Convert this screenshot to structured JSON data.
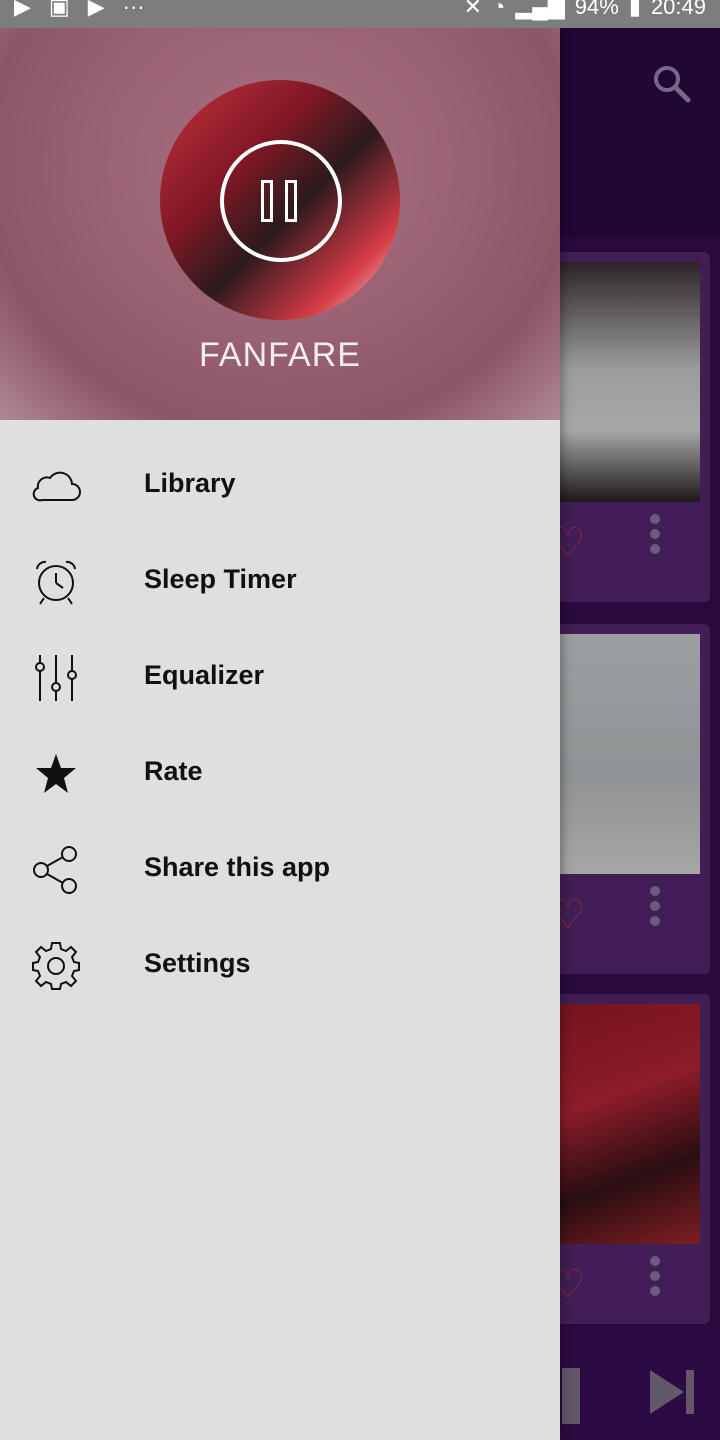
{
  "status_bar": {
    "battery": "94%",
    "time": "20:49"
  },
  "drawer": {
    "header_title": "FANFARE",
    "menu": [
      {
        "label": "Library",
        "icon": "cloud-icon"
      },
      {
        "label": "Sleep Timer",
        "icon": "alarm-clock-icon"
      },
      {
        "label": "Equalizer",
        "icon": "equalizer-icon"
      },
      {
        "label": "Rate",
        "icon": "star-icon"
      },
      {
        "label": "Share this app",
        "icon": "share-icon"
      },
      {
        "label": "Settings",
        "icon": "gear-icon"
      }
    ]
  },
  "colors": {
    "drawer_bg": "#dfdfdf",
    "header_bg": "#9a6374",
    "app_bg": "#3b0f57",
    "heart": "#c2305e"
  }
}
